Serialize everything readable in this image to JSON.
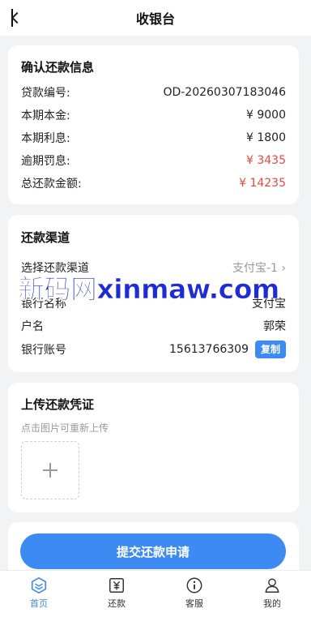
{
  "header": {
    "title": "收银台"
  },
  "info": {
    "title": "确认还款信息",
    "rows": [
      {
        "label": "贷款编号:",
        "value": "OD-20260307183046"
      },
      {
        "label": "本期本金:",
        "value": "¥ 9000"
      },
      {
        "label": "本期利息:",
        "value": "¥ 1800"
      },
      {
        "label": "逾期罚息:",
        "value": "¥ 3435"
      },
      {
        "label": "总还款金额:",
        "value": "¥ 14235"
      }
    ]
  },
  "channel": {
    "title": "还款渠道",
    "select_label": "选择还款渠道",
    "select_value": "支付宝-1 ›",
    "bank_name_label": "银行名称",
    "bank_name_value": "支付宝",
    "holder_label": "户名",
    "holder_value": "郭荣",
    "account_label": "银行账号",
    "account_value": "15613766309",
    "copy_label": "复制"
  },
  "upload": {
    "title": "上传还款凭证",
    "hint": "点击图片可重新上传"
  },
  "submit": {
    "label": "提交还款申请"
  },
  "watermark": {
    "text": "新码网xinmaw.com"
  },
  "tabbar": {
    "items": [
      {
        "label": "首页",
        "icon": "home-icon"
      },
      {
        "label": "还款",
        "icon": "repay-icon"
      },
      {
        "label": "客服",
        "icon": "service-icon"
      },
      {
        "label": "我的",
        "icon": "profile-icon"
      }
    ]
  },
  "colors": {
    "accent": "#3d8bf2",
    "danger": "#f2453d"
  }
}
